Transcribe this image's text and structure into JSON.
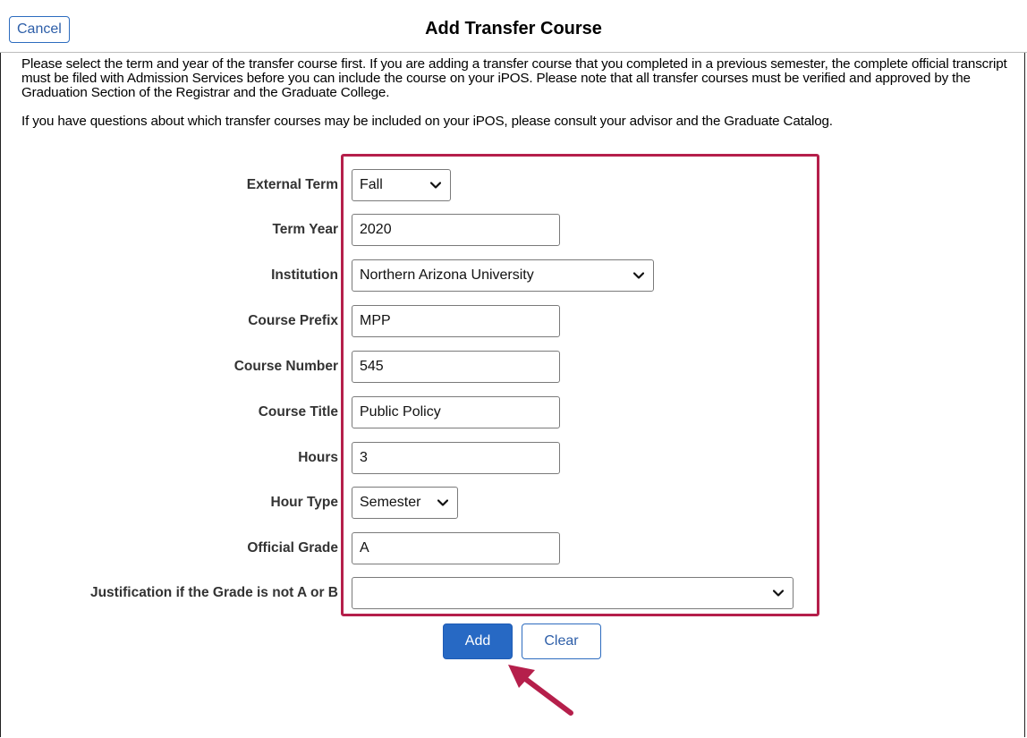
{
  "header": {
    "cancel_label": "Cancel",
    "title": "Add Transfer Course"
  },
  "intro": {
    "paragraph1": "Please select the term and year of the transfer course first. If you are adding a transfer course that you completed in a previous semester, the complete official transcript must be filed with Admission Services before you can include the course on your iPOS. Please note that all transfer courses must be verified and approved by the Graduation Section of the Registrar and the Graduate College.",
    "paragraph2": "If you have questions about which transfer courses may be included on your iPOS, please consult your advisor and the Graduate Catalog."
  },
  "form": {
    "external_term": {
      "label": "External Term",
      "value": "Fall"
    },
    "term_year": {
      "label": "Term Year",
      "value": "2020"
    },
    "institution": {
      "label": "Institution",
      "value": "Northern Arizona University"
    },
    "course_prefix": {
      "label": "Course Prefix",
      "value": "MPP"
    },
    "course_number": {
      "label": "Course Number",
      "value": "545"
    },
    "course_title": {
      "label": "Course Title",
      "value": "Public Policy"
    },
    "hours": {
      "label": "Hours",
      "value": "3"
    },
    "hour_type": {
      "label": "Hour Type",
      "value": "Semester"
    },
    "official_grade": {
      "label": "Official Grade",
      "value": "A"
    },
    "justification": {
      "label": "Justification if the Grade is not A or B",
      "value": ""
    }
  },
  "actions": {
    "add_label": "Add",
    "clear_label": "Clear"
  },
  "colors": {
    "accent_blue": "#2769c4",
    "highlight_red": "#b51f4b"
  },
  "icons": {
    "dropdown": "chevron-down-icon",
    "annotation": "arrow-icon"
  }
}
